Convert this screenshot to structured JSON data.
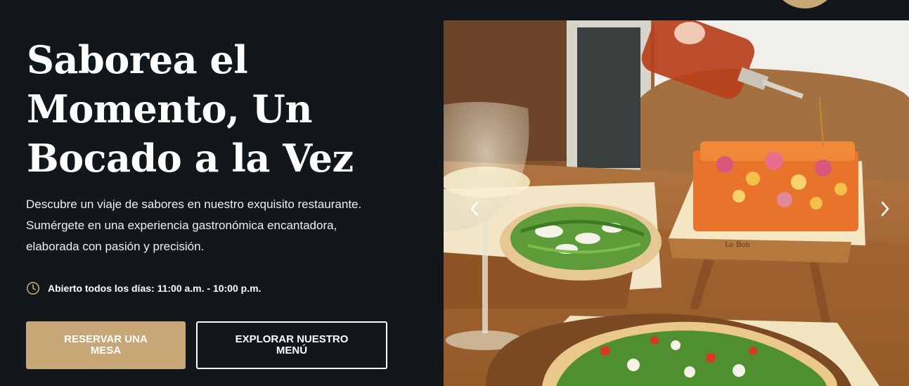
{
  "hero": {
    "headline_lines": [
      "Saborea el",
      "Momento, Un",
      "Bocado a la Vez"
    ],
    "intro_lines": [
      "Descubre un viaje de sabores en nuestro exquisito restaurante.",
      "Sumérgete en una experiencia gastronómica encantadora,",
      "elaborada con pasión y precisión."
    ],
    "hours_text": "Abierto todos los días: 11:00 a.m. - 10:00 p.m.",
    "hours_icon": "clock-icon",
    "buttons": {
      "reserve_label": "RESERVAR UNA MESA",
      "menu_label": "EXPLORAR NUESTRO MENÚ"
    }
  },
  "carousel": {
    "image_alt": "Pizzas con rúcula, queso y cebolla encurtida servidas con una copa de vino blanco",
    "board_brand": "Lo Bon",
    "prev_icon": "chevron-left-icon",
    "next_icon": "chevron-right-icon"
  },
  "colors": {
    "background": "#11171a",
    "accent": "#c7a678",
    "text": "#ffffff"
  }
}
